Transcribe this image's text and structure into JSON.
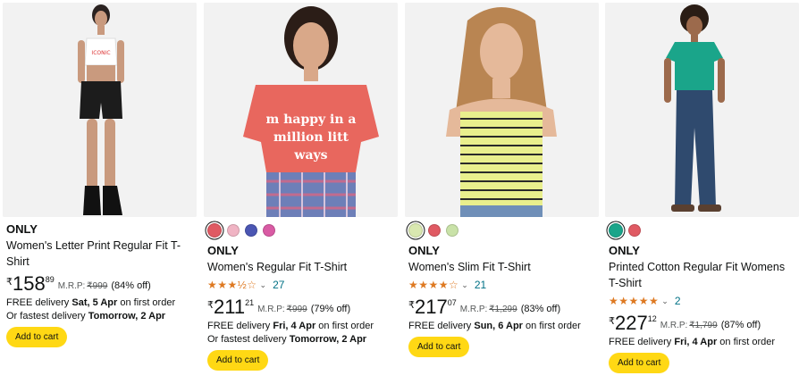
{
  "products": [
    {
      "brand": "ONLY",
      "title": "Women's Letter Print Regular Fit T-Shirt",
      "swatches": [],
      "rating": null,
      "price_symbol": "₹",
      "price_whole": "158",
      "price_fraction": "89",
      "mrp_label": "M.R.P:",
      "mrp_value": "₹999",
      "discount": "(84% off)",
      "delivery_line1_prefix": "FREE delivery ",
      "delivery_line1_bold": "Sat, 5 Apr",
      "delivery_line1_suffix": " on first order",
      "delivery_line2_prefix": "Or fastest delivery ",
      "delivery_line2_bold": "Tomorrow, 2 Apr",
      "add_to_cart": "Add to cart",
      "image_bg": "#f2f2f2"
    },
    {
      "brand": "ONLY",
      "title": "Women's Regular Fit T-Shirt",
      "swatches": [
        "#e05a63",
        "#f0b4c4",
        "#4b56b3",
        "#d95ba4"
      ],
      "rating": {
        "stars": "★★★½☆",
        "count": "27"
      },
      "price_symbol": "₹",
      "price_whole": "211",
      "price_fraction": "21",
      "mrp_label": "M.R.P:",
      "mrp_value": "₹999",
      "discount": "(79% off)",
      "delivery_line1_prefix": "FREE delivery ",
      "delivery_line1_bold": "Fri, 4 Apr",
      "delivery_line1_suffix": " on first order",
      "delivery_line2_prefix": "Or fastest delivery ",
      "delivery_line2_bold": "Tomorrow, 2 Apr",
      "add_to_cart": "Add to cart",
      "shirt_text": "m happy in a million litt ways",
      "image_bg": "#f2f2f2"
    },
    {
      "brand": "ONLY",
      "title": "Women's Slim Fit T-Shirt",
      "swatches": [
        "#d9e8b0",
        "#e05a63",
        "#c9e2a8"
      ],
      "rating": {
        "stars": "★★★★☆",
        "count": "21"
      },
      "price_symbol": "₹",
      "price_whole": "217",
      "price_fraction": "07",
      "mrp_label": "M.R.P:",
      "mrp_value": "₹1,299",
      "discount": "(83% off)",
      "delivery_line1_prefix": "FREE delivery ",
      "delivery_line1_bold": "Sun, 6 Apr",
      "delivery_line1_suffix": " on first order",
      "delivery_line2_prefix": "",
      "delivery_line2_bold": "",
      "add_to_cart": "Add to cart",
      "image_bg": "#f2f2f2"
    },
    {
      "brand": "ONLY",
      "title": "Printed Cotton Regular Fit Womens T-Shirt",
      "swatches": [
        "#1aa58a",
        "#e05a63"
      ],
      "rating": {
        "stars": "★★★★★",
        "count": "2"
      },
      "price_symbol": "₹",
      "price_whole": "227",
      "price_fraction": "12",
      "mrp_label": "M.R.P:",
      "mrp_value": "₹1,799",
      "discount": "(87% off)",
      "delivery_line1_prefix": "FREE delivery ",
      "delivery_line1_bold": "Fri, 4 Apr",
      "delivery_line1_suffix": " on first order",
      "delivery_line2_prefix": "",
      "delivery_line2_bold": "",
      "add_to_cart": "Add to cart",
      "image_bg": "#f2f2f2"
    }
  ],
  "colors": {
    "button": "#ffd814",
    "star": "#de7921",
    "link": "#007185"
  }
}
